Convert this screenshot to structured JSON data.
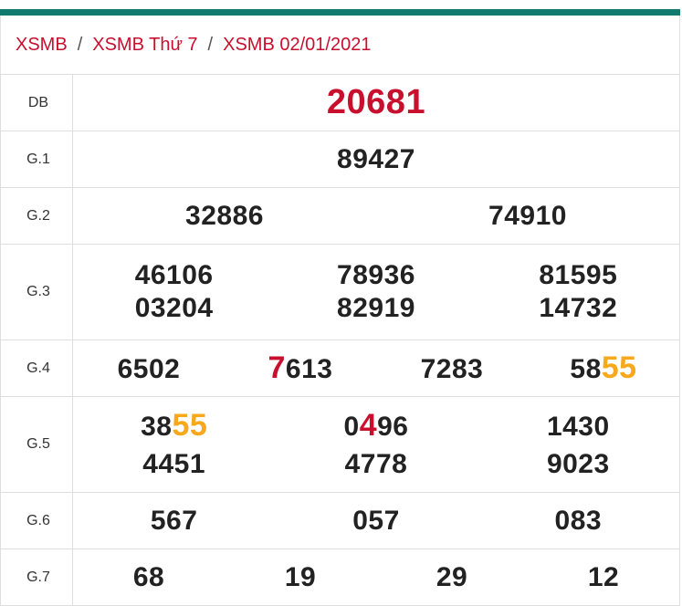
{
  "breadcrumb": {
    "items": [
      "XSMB",
      "XSMB Thứ 7",
      "XSMB 02/01/2021"
    ],
    "separator": "/"
  },
  "colors": {
    "accent_bar": "#117a6f",
    "brand_red": "#c8102e",
    "highlight_orange": "#f7a81b"
  },
  "prizes": {
    "db": {
      "label": "DB",
      "numbers": [
        "20681"
      ]
    },
    "g1": {
      "label": "G.1",
      "numbers": [
        "89427"
      ]
    },
    "g2": {
      "label": "G.2",
      "numbers": [
        "32886",
        "74910"
      ]
    },
    "g3": {
      "label": "G.3",
      "numbers": [
        "46106",
        "78936",
        "81595",
        "03204",
        "82919",
        "14732"
      ]
    },
    "g4": {
      "label": "G.4",
      "numbers": [
        {
          "pre": "6502",
          "hl": "",
          "post": ""
        },
        {
          "pre": "",
          "hl": "7",
          "post": "613"
        },
        {
          "pre": "7283",
          "hl": "",
          "post": ""
        },
        {
          "pre": "58",
          "hl": "55",
          "post": ""
        }
      ]
    },
    "g5": {
      "label": "G.5",
      "numbers": [
        {
          "pre": "38",
          "hl": "55",
          "post": ""
        },
        {
          "pre": "0",
          "hl": "4",
          "post": "96"
        },
        {
          "pre": "1430",
          "hl": "",
          "post": ""
        },
        {
          "pre": "4451",
          "hl": "",
          "post": ""
        },
        {
          "pre": "4778",
          "hl": "",
          "post": ""
        },
        {
          "pre": "9023",
          "hl": "",
          "post": ""
        }
      ]
    },
    "g6": {
      "label": "G.6",
      "numbers": [
        "567",
        "057",
        "083"
      ]
    },
    "g7": {
      "label": "G.7",
      "numbers": [
        "68",
        "19",
        "29",
        "12"
      ]
    }
  }
}
